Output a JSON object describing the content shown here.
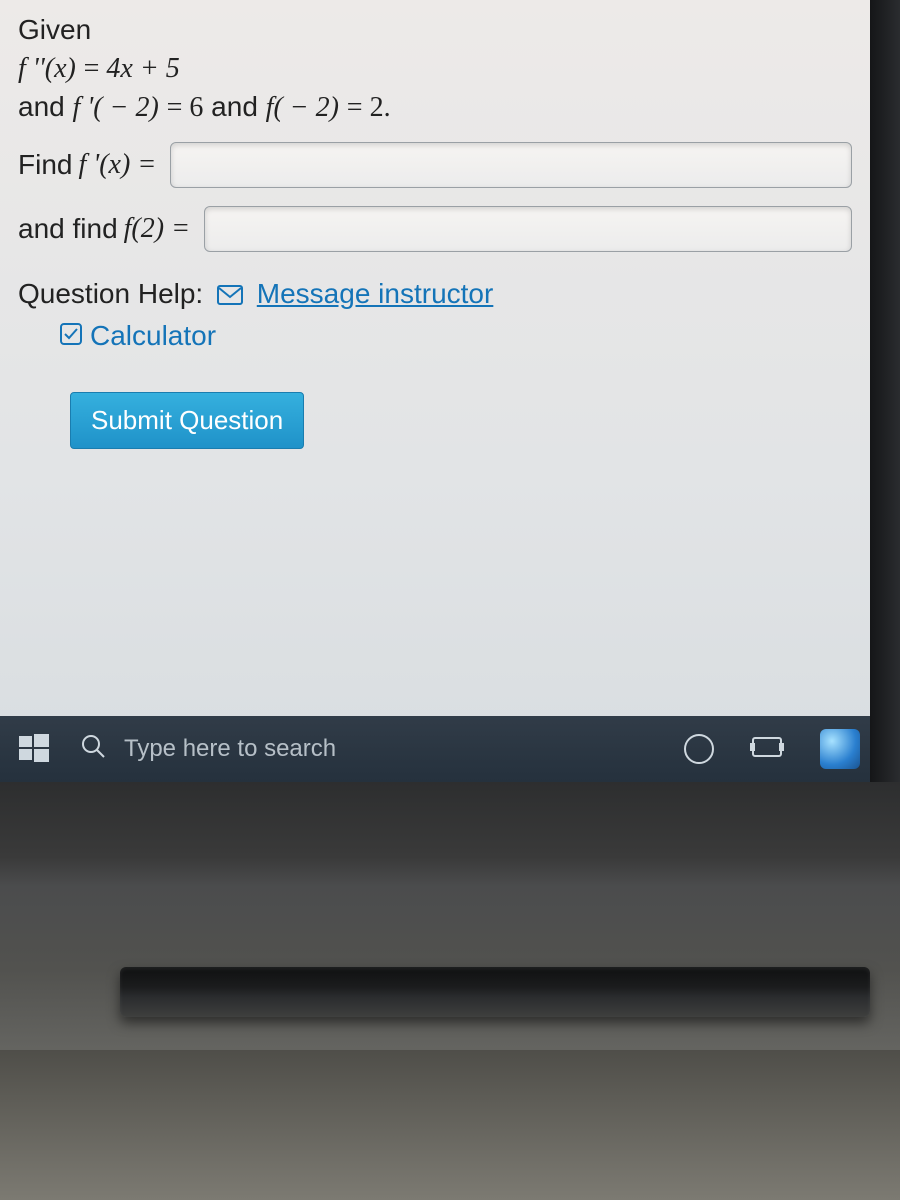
{
  "problem": {
    "given_label": "Given",
    "eq1_lhs": "f ''(x)",
    "eq1_rhs": "4x + 5",
    "initconds_prefix": "and ",
    "initcond1_lhs": "f '( − 2)",
    "initcond1_rhs": "6",
    "initconds_joiner": " and ",
    "initcond2_lhs": "f( − 2)",
    "initcond2_rhs": "2.",
    "prompt1_prefix": "Find ",
    "prompt1_expr": "f '(x) =",
    "prompt2_prefix": "and find ",
    "prompt2_expr": "f(2) ="
  },
  "help": {
    "label": "Question Help:",
    "message_link": "Message instructor",
    "calculator": "Calculator"
  },
  "actions": {
    "submit": "Submit Question"
  },
  "taskbar": {
    "search_placeholder": "Type here to search"
  }
}
